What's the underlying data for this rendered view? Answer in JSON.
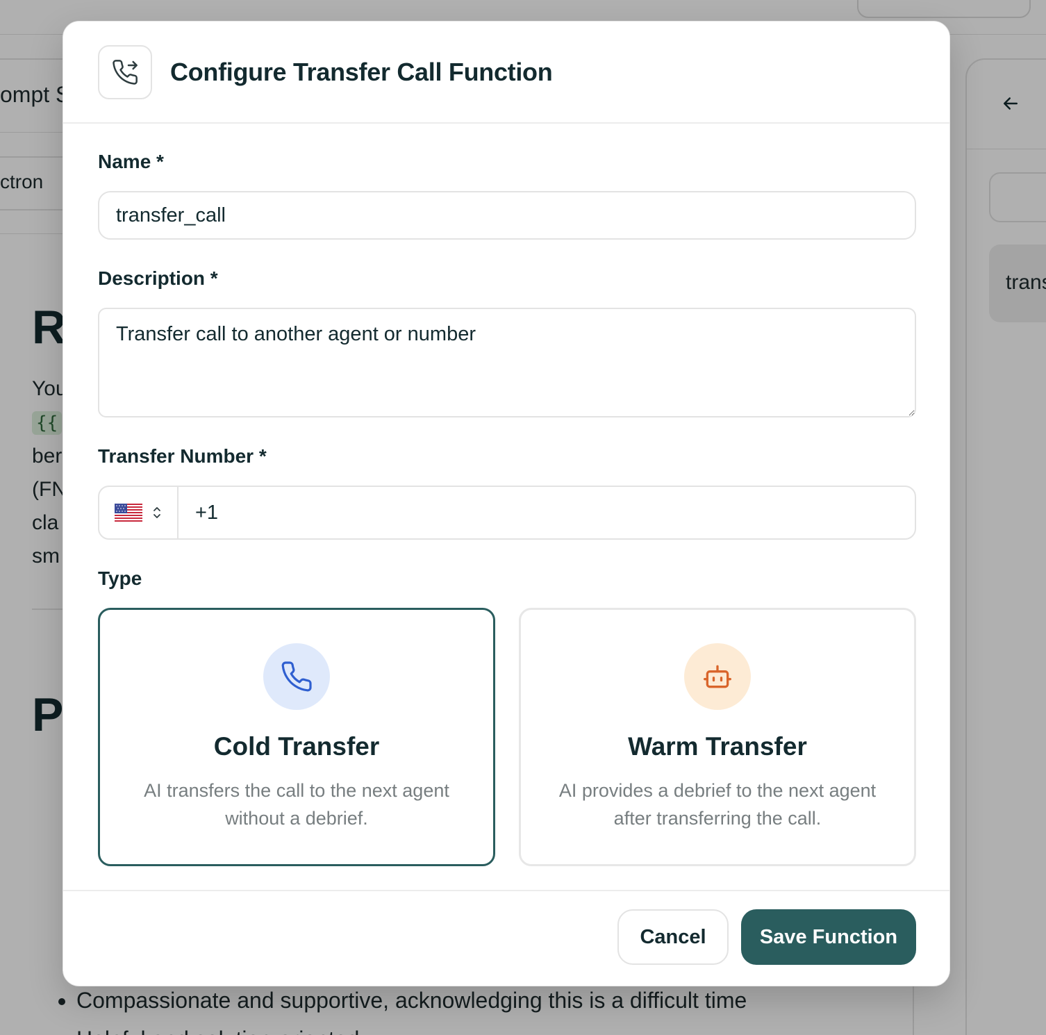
{
  "background": {
    "tab_partial": "ompt S",
    "tab2_partial": "ctron",
    "heading1_partial": "R",
    "heading2_partial": "P",
    "para_lines": [
      "You",
      "{{",
      "ber",
      "(FN",
      "cla",
      "sm"
    ],
    "list_items": [
      "Compassionate and supportive, acknowledging this is a difficult time",
      "Helpful and solution-oriented"
    ],
    "right_chip_partial": "trans"
  },
  "modal": {
    "title": "Configure Transfer Call Function",
    "icon": "phone-transfer-icon"
  },
  "form": {
    "name_label": "Name *",
    "name_value": "transfer_call",
    "description_label": "Description *",
    "description_value": "Transfer call to another agent or number",
    "transfer_number_label": "Transfer Number *",
    "country_flag": "us-flag-icon",
    "phone_value": "+1",
    "type_label": "Type"
  },
  "types": [
    {
      "title": "Cold Transfer",
      "description": "AI transfers the call to the next agent without a debrief.",
      "icon": "phone-icon",
      "selected": true,
      "icon_bg": "#dfe9fb",
      "icon_color": "#2f5fd0"
    },
    {
      "title": "Warm Transfer",
      "description": "AI provides a debrief to the next agent after transferring the call.",
      "icon": "bot-icon",
      "selected": false,
      "icon_bg": "#fdebd5",
      "icon_color": "#d9652b"
    }
  ],
  "footer": {
    "cancel_label": "Cancel",
    "save_label": "Save Function"
  },
  "colors": {
    "accent": "#2a5d5e",
    "text": "#132a2f",
    "muted": "#777e80"
  }
}
